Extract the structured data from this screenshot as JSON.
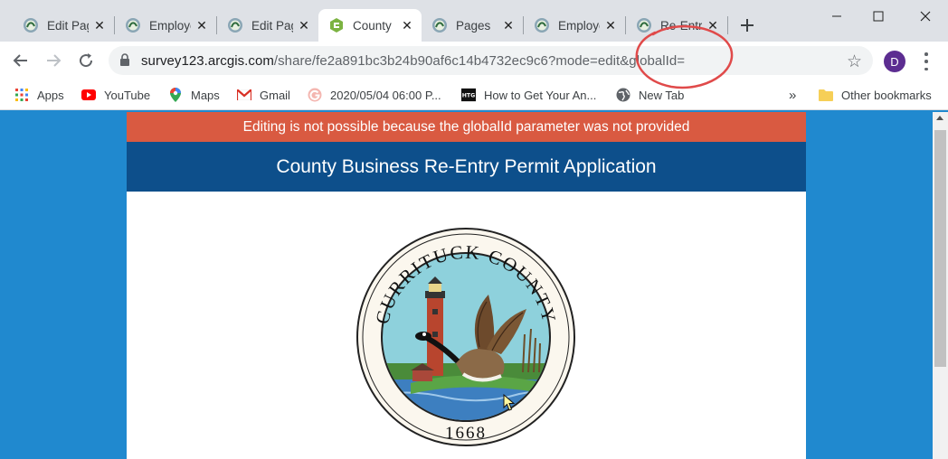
{
  "tabs": [
    {
      "title": "Edit Pages",
      "icon": "survey123-icon",
      "active": false
    },
    {
      "title": "Employee",
      "icon": "survey123-icon",
      "active": false
    },
    {
      "title": "Edit Pages",
      "icon": "survey123-icon",
      "active": false
    },
    {
      "title": "County Business",
      "icon": "green-hexagon-icon",
      "active": true
    },
    {
      "title": "Pages",
      "icon": "survey123-icon",
      "active": false
    },
    {
      "title": "Employee",
      "icon": "survey123-icon",
      "active": false
    },
    {
      "title": "Re-Entry",
      "icon": "survey123-icon",
      "active": false
    }
  ],
  "toolbar": {
    "url_host": "survey123.arcgis.com",
    "url_rest": "/share/fe2a891bc3b24b90af6c14b4732ec9c6?mode=edit&globalId=",
    "profile_initial": "D"
  },
  "bookmarks": {
    "items": [
      {
        "label": "Apps",
        "icon": "apps-grid-icon"
      },
      {
        "label": "YouTube",
        "icon": "youtube-icon"
      },
      {
        "label": "Maps",
        "icon": "maps-pin-icon"
      },
      {
        "label": "Gmail",
        "icon": "gmail-icon"
      },
      {
        "label": "2020/05/04 06:00 P...",
        "icon": "g-circle-icon"
      },
      {
        "label": "How to Get Your An...",
        "icon": "htg-icon"
      },
      {
        "label": "New Tab",
        "icon": "globe-icon"
      }
    ],
    "overflow": "»",
    "other": "Other bookmarks"
  },
  "page": {
    "error_banner": "Editing is not possible because the globalId parameter was not provided",
    "form_title": "County Business Re-Entry Permit Application",
    "seal": {
      "top_text": "CURRITUCK COUNTY",
      "year": "1668"
    }
  },
  "colors": {
    "page_bg": "#2089cf",
    "banner_error": "#d95a41",
    "header_blue": "#0d4f8b",
    "annotation": "#e04a4a"
  }
}
